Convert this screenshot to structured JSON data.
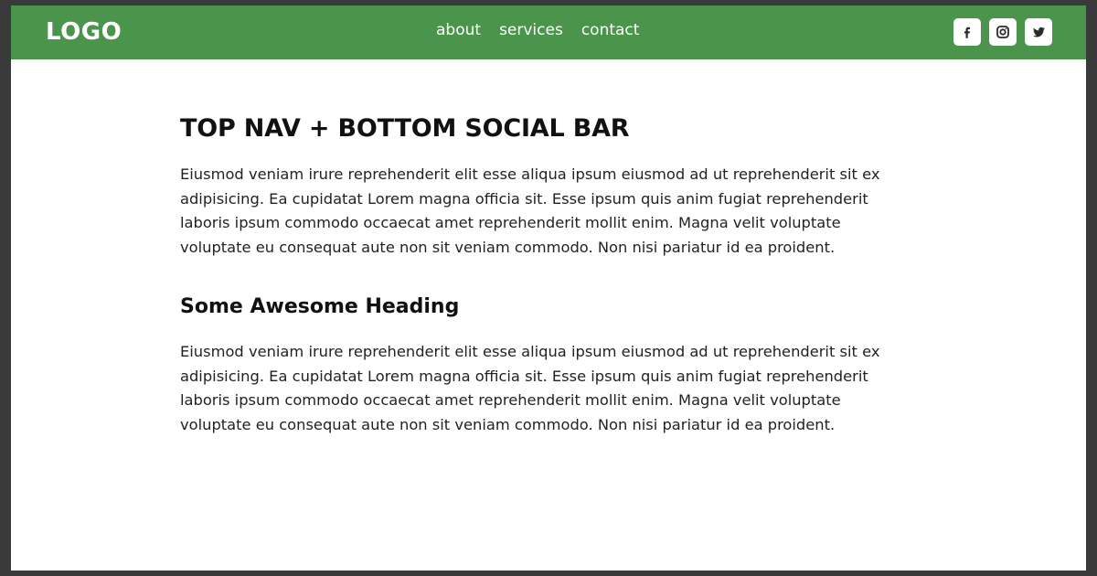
{
  "header": {
    "logo": "LOGO",
    "nav": [
      "about",
      "services",
      "contact"
    ],
    "social": [
      {
        "name": "facebook",
        "icon": "facebook-icon"
      },
      {
        "name": "instagram",
        "icon": "instagram-icon"
      },
      {
        "name": "twitter",
        "icon": "twitter-icon"
      }
    ]
  },
  "main": {
    "title": "TOP NAV + BOTTOM SOCIAL BAR",
    "paragraph1": "Eiusmod veniam irure reprehenderit elit esse aliqua ipsum eiusmod ad ut reprehenderit sit ex adipisicing. Ea cupidatat Lorem magna officia sit. Esse ipsum quis anim fugiat reprehenderit laboris ipsum commodo occaecat amet reprehenderit mollit enim. Magna velit voluptate voluptate eu consequat aute non sit veniam commodo. Non nisi pariatur id ea proident.",
    "heading2": "Some Awesome Heading",
    "paragraph2": "Eiusmod veniam irure reprehenderit elit esse aliqua ipsum eiusmod ad ut reprehenderit sit ex adipisicing. Ea cupidatat Lorem magna officia sit. Esse ipsum quis anim fugiat reprehenderit laboris ipsum commodo occaecat amet reprehenderit mollit enim. Magna velit voluptate voluptate eu consequat aute non sit veniam commodo. Non nisi pariatur id ea proident."
  },
  "colors": {
    "header_bg": "#4a944c",
    "page_bg": "#ffffff",
    "outer_frame": "#3a3a3a",
    "text": "#222222",
    "icon_fg": "#2b2b2b"
  }
}
